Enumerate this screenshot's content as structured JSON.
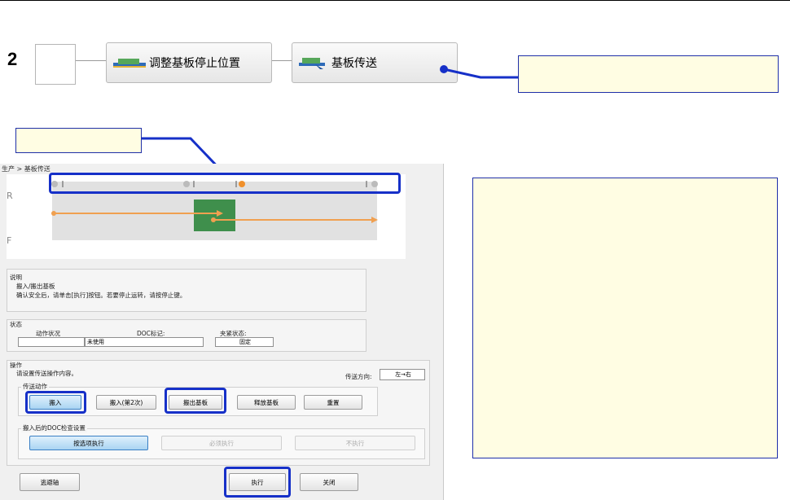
{
  "step": {
    "number": "2"
  },
  "toolbar": {
    "adjust_stop_label": "调整基板停止位置",
    "transfer_label": "基板传送"
  },
  "window": {
    "breadcrumb": "生产 > 基板传送",
    "rail_labels": {
      "rear": "R",
      "front": "F"
    },
    "description": {
      "title": "说明",
      "line1": "搬入/搬出基板",
      "line2": "确认安全后，请单击[执行]按钮。若要停止运转，请按停止键。"
    },
    "status": {
      "title": "状态",
      "action_label": "动作状况",
      "action_value": "",
      "doc_label": "DOC标记:",
      "doc_value": "未使用",
      "clamp_label": "夹紧状态:",
      "clamp_value": "固定"
    },
    "operation": {
      "title": "操作",
      "hint": "请设置传送操作内容。",
      "direction_label": "传送方向:",
      "direction_value": "左→右",
      "transfer_group": "传送动作",
      "buttons": [
        "搬入",
        "搬入(第2次)",
        "搬出基板",
        "释放基板",
        "重置"
      ],
      "doc_group": "搬入后的DOC检查设置",
      "doc_buttons": [
        "按选项执行",
        "必须执行",
        "不执行"
      ]
    },
    "footer": {
      "axis_button": "逃避轴",
      "execute_button": "执行",
      "close_button": "关闭"
    }
  },
  "colors": {
    "highlight": "#1630c8",
    "note_background": "#fffde3",
    "board_green": "#3f8f4c",
    "flow_orange": "#f0a050"
  }
}
